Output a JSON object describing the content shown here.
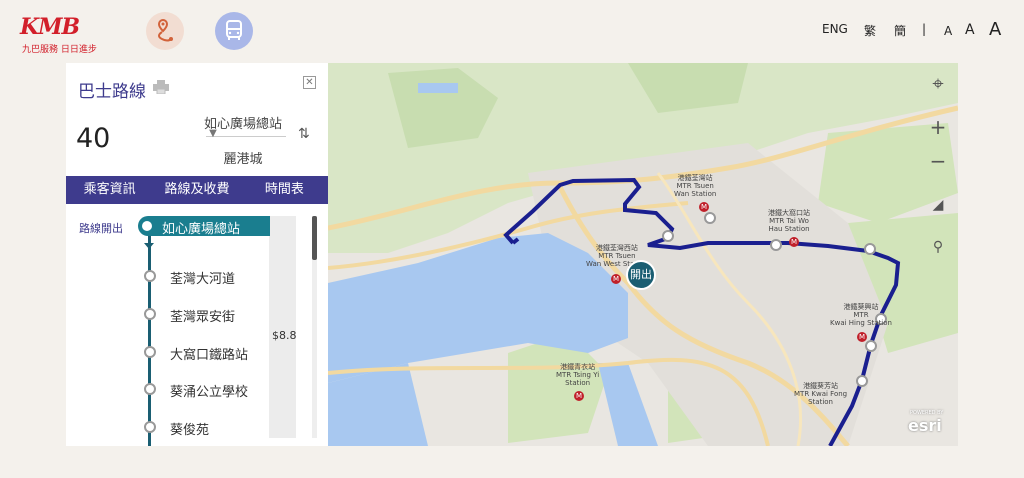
{
  "header": {
    "logo_text": "KMB",
    "logo_subtitle": "九巴服務 日日進步",
    "lang_eng": "ENG",
    "lang_trad": "繁",
    "lang_simp": "簡",
    "separator": "|",
    "font_small": "A",
    "font_medium": "A",
    "font_large": "A"
  },
  "panel": {
    "title": "巴士路線",
    "route_number": "40",
    "origin": "如心廣場總站",
    "destination": "麗港城",
    "tabs": [
      {
        "label": "乘客資訊"
      },
      {
        "label": "路線及收費"
      },
      {
        "label": "時間表"
      }
    ],
    "direction_label": "路線開出",
    "stops": [
      {
        "name": "如心廣場總站"
      },
      {
        "name": "荃灣大河道"
      },
      {
        "name": "荃灣眾安街"
      },
      {
        "name": "大窩口鐵路站"
      },
      {
        "name": "葵涌公立學校"
      },
      {
        "name": "葵俊苑"
      }
    ],
    "fare": "$8.8"
  },
  "map": {
    "start_marker": "開出",
    "labels": {
      "tsuen_wan": "港鐵荃灣站\nMTR Tsuen\nWan Station",
      "tai_wo_hau": "港鐵大窩口站\nMTR Tai Wo\nHau Station",
      "tsuen_wan_west": "港鐵荃灣西站\nMTR Tsuen\nWan West Station",
      "kwai_hing": "港鐵葵興站\nMTR\nKwai Hing Station",
      "tsing_yi": "港鐵青衣站\nMTR Tsing Yi\nStation",
      "kwai_fong": "港鐵葵芳站\nMTR Kwai Fong\nStation"
    },
    "attribution": "esri",
    "attribution_small": "POWERED BY"
  },
  "colors": {
    "brand_purple": "#3e3b8d",
    "kmb_red": "#d21f2a",
    "route_blue": "#1a1f8f",
    "teal": "#1a7e8f"
  }
}
